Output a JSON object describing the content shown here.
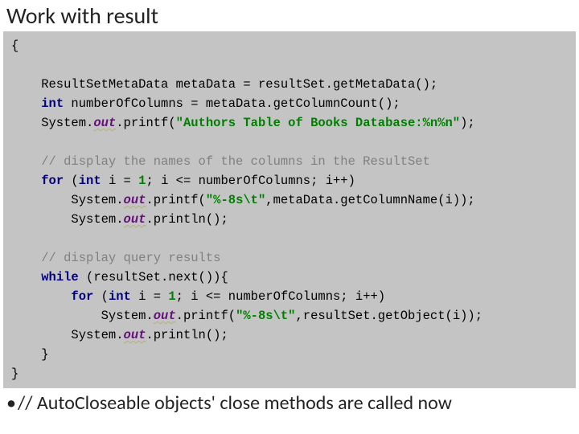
{
  "title": "Work with result",
  "code": {
    "l1": "{",
    "l2a": "    ResultSetMetaData metaData = resultSet.getMetaData();",
    "l3_kw": "int",
    "l3_rest": " numberOfColumns = metaData.getColumnCount();",
    "l4a": "    System.",
    "l4_out": "out",
    "l4b": ".printf(",
    "l4_str": "\"Authors Table of Books Database:%n%n\"",
    "l4c": ");",
    "l5": "    ",
    "l6_cmt": "// display the names of the columns in the ResultSet",
    "l7_for": "for",
    "l7a": " (",
    "l7_int": "int",
    "l7b": " i = ",
    "l7_n1": "1",
    "l7c": "; i <= numberOfColumns; i++)",
    "l8a": "        System.",
    "l8_out": "out",
    "l8b": ".printf(",
    "l8_str": "\"%-8s\\t\"",
    "l8c": ",metaData.getColumnName(i));",
    "l9a": "        System.",
    "l9_out": "out",
    "l9b": ".println();",
    "l10": "    ",
    "l11_cmt": "// display query results",
    "l12_while": "while",
    "l12a": " (resultSet.next()){",
    "l13_for": "for",
    "l13a": " (",
    "l13_int": "int",
    "l13b": " i = ",
    "l13_n1": "1",
    "l13c": "; i <= numberOfColumns; i++)",
    "l14a": "            System.",
    "l14_out": "out",
    "l14b": ".printf(",
    "l14_str": "\"%-8s\\t\"",
    "l14c": ",resultSet.getObject(i));",
    "l15a": "        System.",
    "l15_out": "out",
    "l15b": ".println();",
    "l16": "    }",
    "l17": "}"
  },
  "bullet": "// AutoCloseable objects' close methods are called now"
}
